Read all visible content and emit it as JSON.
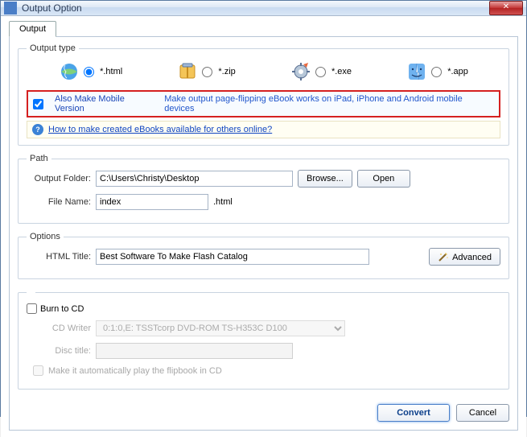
{
  "window": {
    "title": "Output Option"
  },
  "tab": {
    "label": "Output"
  },
  "outputType": {
    "legend": "Output type",
    "html": "*.html",
    "zip": "*.zip",
    "exe": "*.exe",
    "app": "*.app"
  },
  "mobile": {
    "check_label": "Also Make Mobile Version",
    "desc": "Make output page-flipping eBook works on iPad, iPhone and Android mobile devices"
  },
  "help": {
    "link": "How to make created eBooks available for others online?"
  },
  "path": {
    "legend": "Path",
    "folder_label": "Output Folder:",
    "folder_value": "C:\\Users\\Christy\\Desktop",
    "browse": "Browse...",
    "open": "Open",
    "file_label": "File Name:",
    "file_value": "index",
    "ext": ".html"
  },
  "options": {
    "legend": "Options",
    "title_label": "HTML Title:",
    "title_value": "Best Software To Make Flash Catalog",
    "advanced": "Advanced"
  },
  "burn": {
    "check_label": "Burn to CD",
    "writer_label": "CD Writer",
    "writer_value": "0:1:0,E: TSSTcorp DVD-ROM TS-H353C D100",
    "disc_label": "Disc title:",
    "auto_label": "Make it automatically play the flipbook in CD"
  },
  "footer": {
    "convert": "Convert",
    "cancel": "Cancel"
  }
}
